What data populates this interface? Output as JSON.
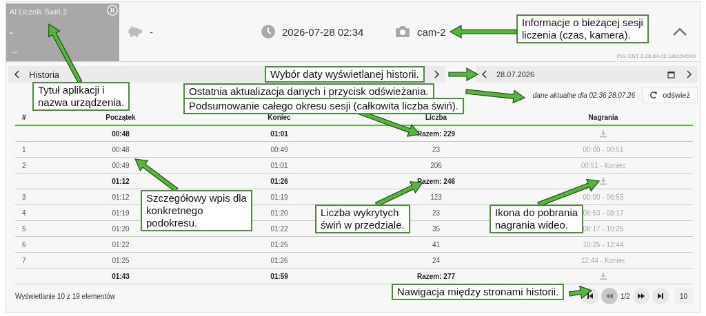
{
  "app_tile": {
    "title": "AI Licznik Świń 2",
    "value": "-",
    "arrow": "→"
  },
  "session": {
    "pig_count": "-",
    "time": "2026-07-28 02:34",
    "camera": "cam-2",
    "version": "PIG CNT 2.26.64.09.180154549"
  },
  "history_bar": {
    "title": "Historia",
    "date": "28.07.2026"
  },
  "refresh": {
    "status": "dane aktualne dla 02:36 28.07.26",
    "button": "odśwież"
  },
  "table": {
    "columns": [
      "#",
      "Początek",
      "Koniec",
      "Liczba",
      "Nagrania"
    ],
    "rows": [
      {
        "kind": "group",
        "start": "00:48",
        "end": "01:01",
        "count": "Razem: 229"
      },
      {
        "kind": "entry",
        "index": "1",
        "start": "00:48",
        "end": "00:49",
        "count": "23",
        "recording": "00:00 - 00:51"
      },
      {
        "kind": "entry",
        "index": "2",
        "start": "00:49",
        "end": "01:01",
        "count": "206",
        "recording": "00:51 - Koniec"
      },
      {
        "kind": "group",
        "start": "01:12",
        "end": "01:26",
        "count": "Razem: 246"
      },
      {
        "kind": "entry",
        "index": "3",
        "start": "01:12",
        "end": "01:19",
        "count": "123",
        "recording": "00:00 - 06:53"
      },
      {
        "kind": "entry",
        "index": "4",
        "start": "01:19",
        "end": "01:20",
        "count": "23",
        "recording": "06:53 - 08:17"
      },
      {
        "kind": "entry",
        "index": "5",
        "start": "01:20",
        "end": "01:22",
        "count": "35",
        "recording": "08:17 - 10:25"
      },
      {
        "kind": "entry",
        "index": "6",
        "start": "01:22",
        "end": "01:25",
        "count": "41",
        "recording": "10:25 - 12:44"
      },
      {
        "kind": "entry",
        "index": "7",
        "start": "01:25",
        "end": "01:26",
        "count": "24",
        "recording": "12:44 - Koniec"
      },
      {
        "kind": "group",
        "start": "01:43",
        "end": "01:59",
        "count": "Razem: 277"
      }
    ]
  },
  "footer": {
    "summary": "Wyświetlanie 10 z 19 elementów",
    "page": "1/2",
    "page_size": "10",
    "pager": [
      {
        "kind": "first",
        "pressed": false
      },
      {
        "kind": "prev",
        "pressed": true
      },
      {
        "kind": "next",
        "pressed": false
      },
      {
        "kind": "last",
        "pressed": false
      }
    ]
  },
  "callouts": [
    {
      "text": "Tytuł aplikacji i\nnazwa urządzenia."
    },
    {
      "text": "Informacje o bieżącej sesji\nliczenia (czas, kamera)."
    },
    {
      "text": "Wybór daty wyświetlanej historii."
    },
    {
      "text": "Ostatnia aktualizacja danych i przycisk odświeżania."
    },
    {
      "text": "Podsumowanie całego okresu sesji (całkowita liczba świń)."
    },
    {
      "text": "Szczegółowy wpis dla\nkonkretnego\npodokresu."
    },
    {
      "text": "Liczba wykrytych\nświń w przedziale."
    },
    {
      "text": "Ikona do pobrania\nnagrania wideo."
    },
    {
      "text": "Nawigacja między stronami historii."
    }
  ]
}
